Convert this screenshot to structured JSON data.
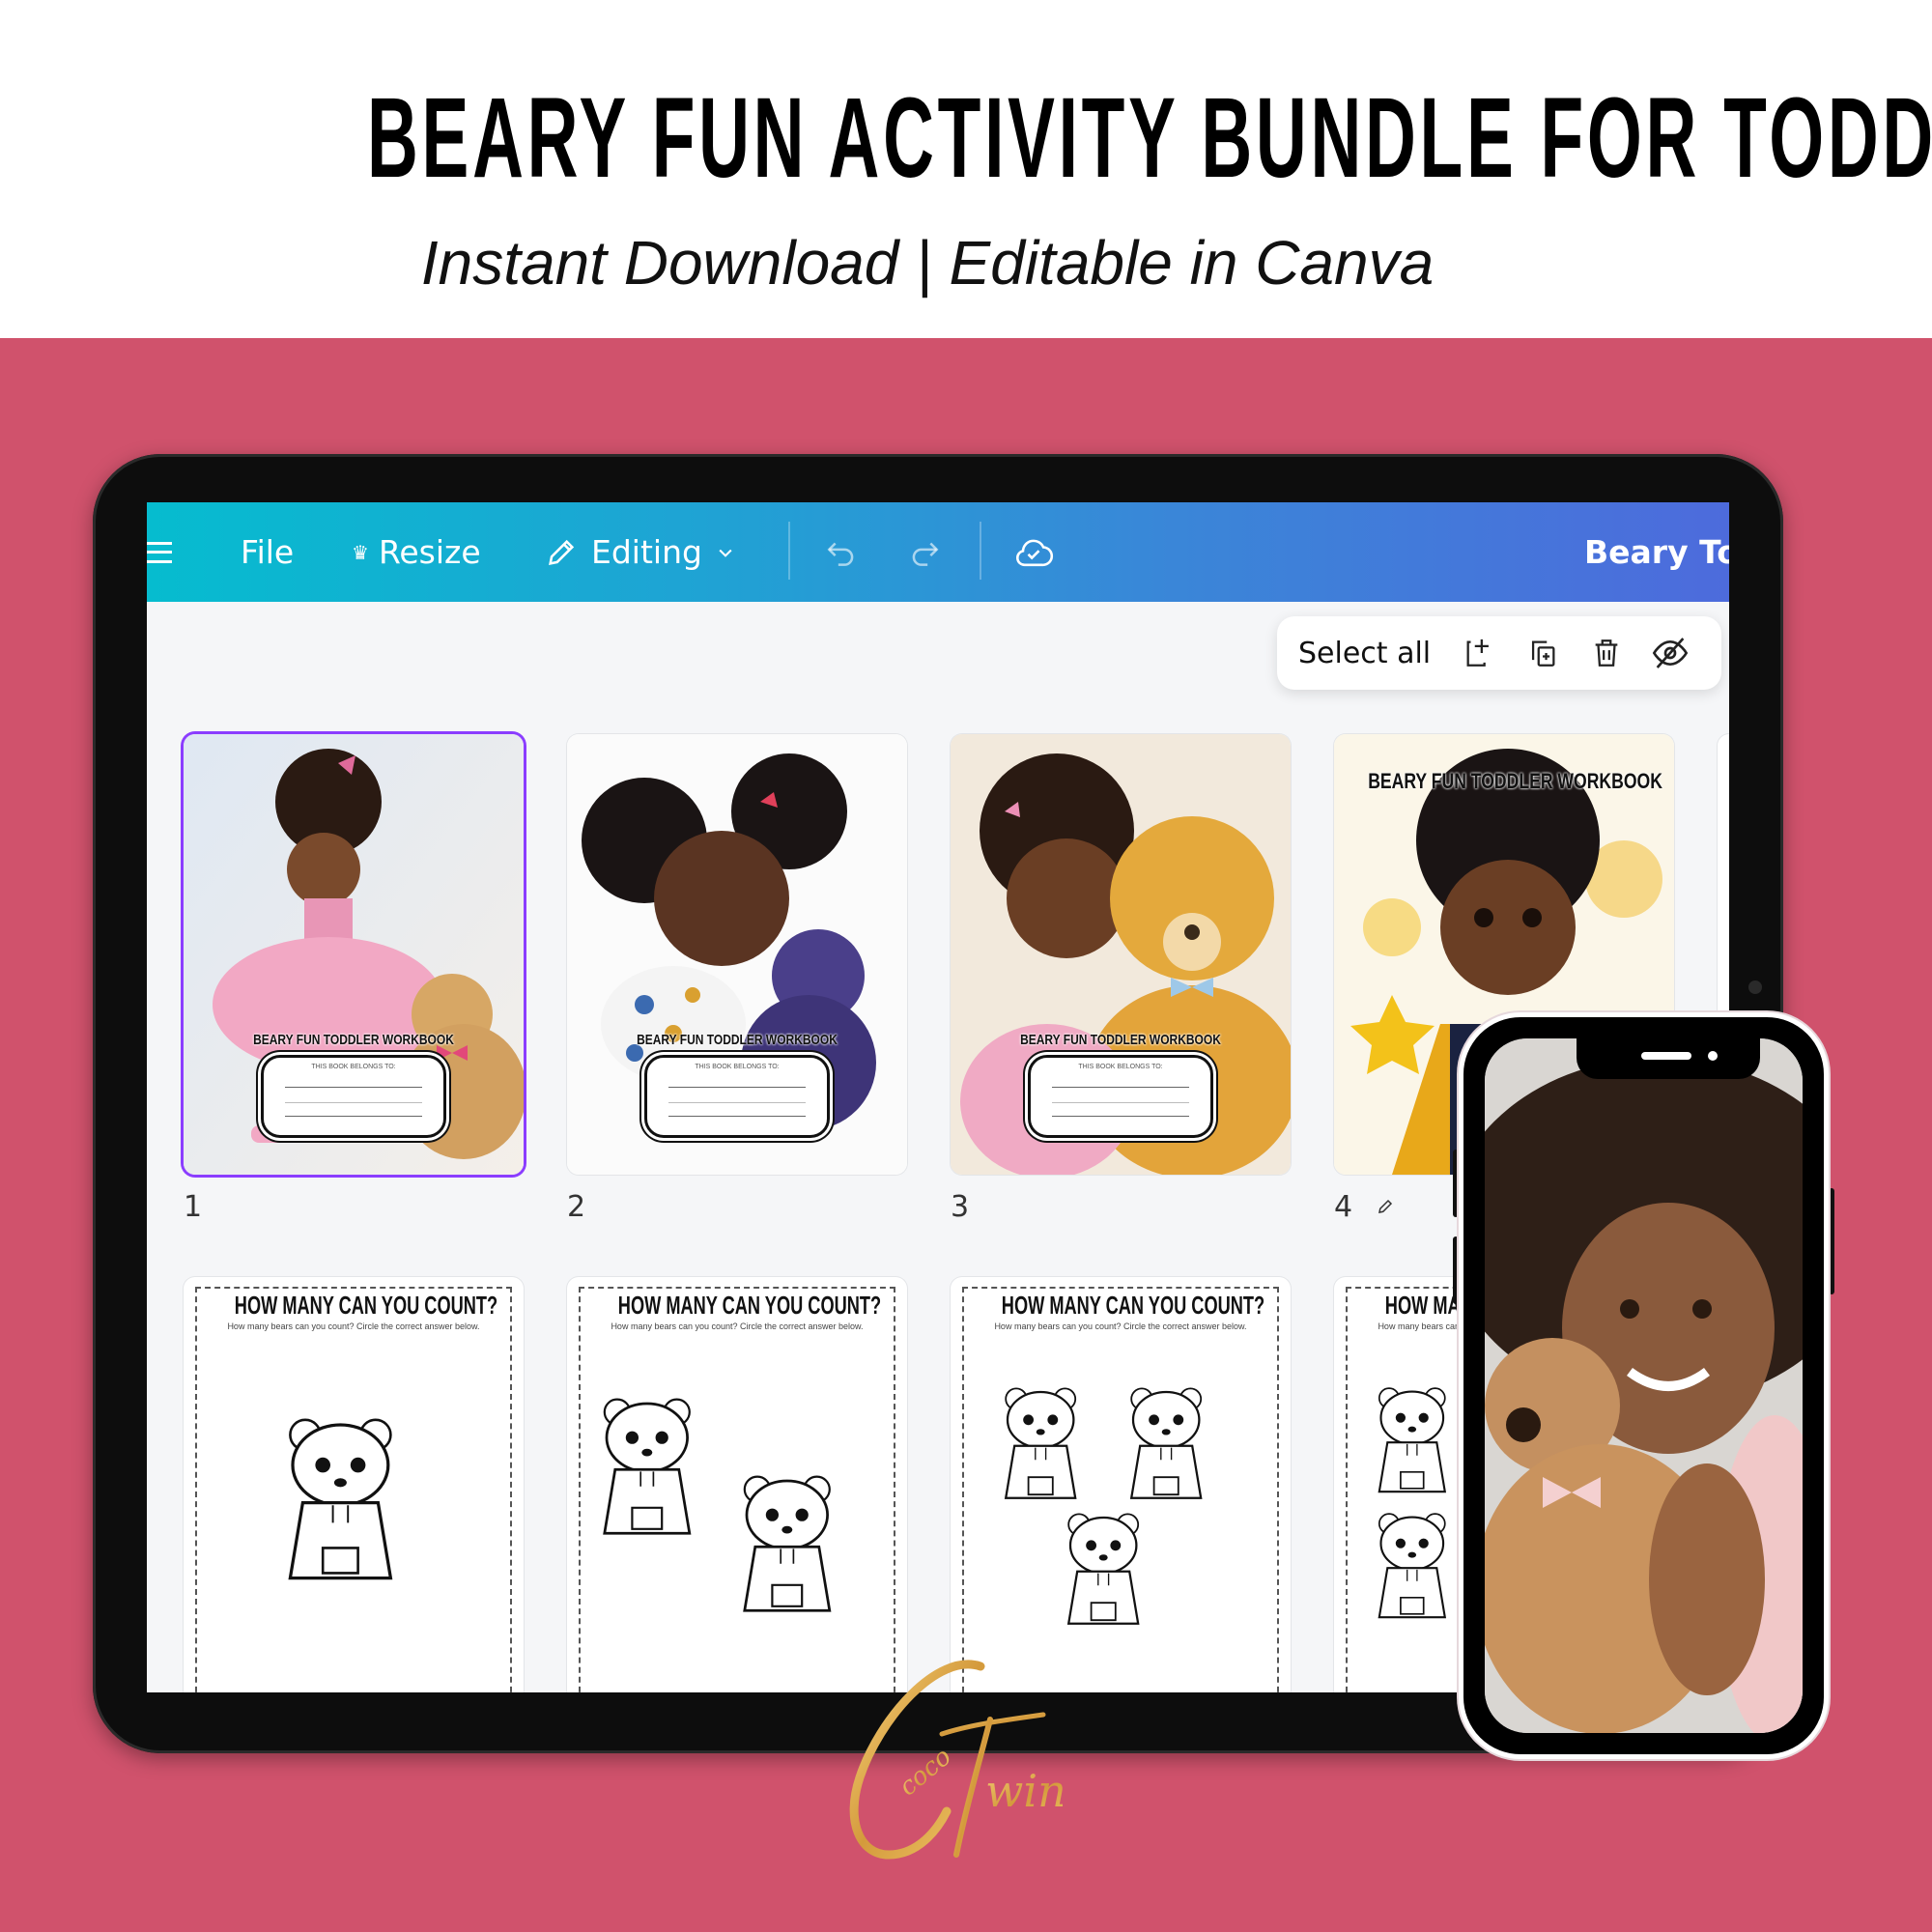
{
  "header": {
    "title": "BEARY FUN ACTIVITY BUNDLE FOR TODDLERS",
    "subtitle": "Instant Download | Editable in Canva"
  },
  "colors": {
    "background": "#d0526c",
    "toolbar_gradient_start": "#06bccf",
    "toolbar_gradient_end": "#4d6bdc",
    "selection": "#8b3dff",
    "logo_gold": "#e0a94a"
  },
  "editor": {
    "toolbar": {
      "menu_icon": "hamburger-icon",
      "file_label": "File",
      "resize_icon": "crown-icon",
      "resize_label": "Resize",
      "editing_icon": "pencil-icon",
      "editing_label": "Editing",
      "editing_chevron": "chevron-down-icon",
      "undo_icon": "undo-icon",
      "redo_icon": "redo-icon",
      "save_icon": "cloud-check-icon",
      "doc_title": "Beary Toc"
    },
    "page_actions": {
      "select_all_label": "Select all",
      "icons": [
        "add-page-icon",
        "duplicate-page-icon",
        "delete-icon",
        "hide-icon"
      ]
    },
    "pages": [
      {
        "number": "1",
        "type": "cover",
        "title": "BEARY FUN TODDLER WORKBOOK",
        "belongs_label": "THIS BOOK BELONGS TO:",
        "selected": true
      },
      {
        "number": "2",
        "type": "cover",
        "title": "BEARY FUN TODDLER WORKBOOK",
        "belongs_label": "THIS BOOK BELONGS TO:",
        "selected": false
      },
      {
        "number": "3",
        "type": "cover",
        "title": "BEARY FUN TODDLER WORKBOOK",
        "belongs_label": "THIS BOOK BELONGS TO:",
        "selected": false
      },
      {
        "number": "4",
        "type": "cover",
        "title": "BEARY FUN TODDLER WORKBOOK",
        "selected": false,
        "edit_icon": "pencil-icon"
      },
      {
        "type": "worksheet",
        "title": "HOW MANY CAN YOU COUNT?",
        "instruction": "How many bears can you count? Circle the correct answer below.",
        "bear_count": 1
      },
      {
        "type": "worksheet",
        "title": "HOW MANY CAN YOU COUNT?",
        "instruction": "How many bears can you count? Circle the correct answer below.",
        "bear_count": 2
      },
      {
        "type": "worksheet",
        "title": "HOW MANY CAN YOU COUNT?",
        "instruction": "How many bears can you count? Circle the correct answer below.",
        "bear_count": 3
      },
      {
        "type": "worksheet",
        "title": "HOW MANY CAN YOU COUNT?",
        "instruction": "How many bears can you count? Circle the correct answer below.",
        "bear_count": 4
      }
    ]
  },
  "logo": {
    "text": "CocoTwins"
  }
}
